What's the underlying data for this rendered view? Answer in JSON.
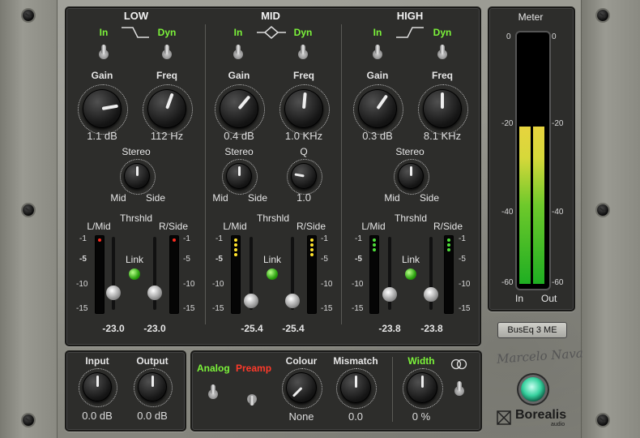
{
  "bands": [
    {
      "title": "LOW",
      "in_label": "In",
      "dyn_label": "Dyn",
      "gain_label": "Gain",
      "freq_label": "Freq",
      "gain_value": "1.1 dB",
      "freq_value": "112 Hz",
      "stereo_label": "Stereo",
      "mid_label": "Mid",
      "side_label": "Side",
      "thrshld_label": "Thrshld",
      "lmid_label": "L/Mid",
      "rside_label": "R/Side",
      "link_label": "Link",
      "thr_left": "-23.0",
      "thr_right": "-23.0"
    },
    {
      "title": "MID",
      "in_label": "In",
      "dyn_label": "Dyn",
      "gain_label": "Gain",
      "freq_label": "Freq",
      "gain_value": "0.4 dB",
      "freq_value": "1.0 KHz",
      "stereo_label": "Stereo",
      "mid_label": "Mid",
      "side_label": "Side",
      "q_label": "Q",
      "q_value": "1.0",
      "thrshld_label": "Thrshld",
      "lmid_label": "L/Mid",
      "rside_label": "R/Side",
      "link_label": "Link",
      "thr_left": "-25.4",
      "thr_right": "-25.4"
    },
    {
      "title": "HIGH",
      "in_label": "In",
      "dyn_label": "Dyn",
      "gain_label": "Gain",
      "freq_label": "Freq",
      "gain_value": "0.3 dB",
      "freq_value": "8.1 KHz",
      "stereo_label": "Stereo",
      "mid_label": "Mid",
      "side_label": "Side",
      "thrshld_label": "Thrshld",
      "lmid_label": "L/Mid",
      "rside_label": "R/Side",
      "link_label": "Link",
      "thr_left": "-23.8",
      "thr_right": "-23.8"
    }
  ],
  "scale": [
    "-1",
    "-5",
    "-10",
    "-15"
  ],
  "meter": {
    "title": "Meter",
    "ticks": [
      "0",
      "-20",
      "-40",
      "-60"
    ],
    "in_label": "In",
    "out_label": "Out",
    "in_level_db": -22,
    "out_level_db": -22
  },
  "preset": {
    "name": "BusEq 3 ME"
  },
  "io": {
    "input_label": "Input",
    "output_label": "Output",
    "input_value": "0.0 dB",
    "output_value": "0.0 dB"
  },
  "analog": {
    "analog_label": "Analog",
    "preamp_label": "Preamp",
    "colour_label": "Colour",
    "mismatch_label": "Mismatch",
    "width_label": "Width",
    "colour_value": "None",
    "mismatch_value": "0.0",
    "width_value": "0 %"
  },
  "brand": {
    "signature": "Marcelo Nava",
    "name": "Borealis",
    "sub": "audio"
  },
  "colors": {
    "active_green": "#7cf33a",
    "preamp_red": "#ff3a2a",
    "power_teal": "#36d19e"
  }
}
